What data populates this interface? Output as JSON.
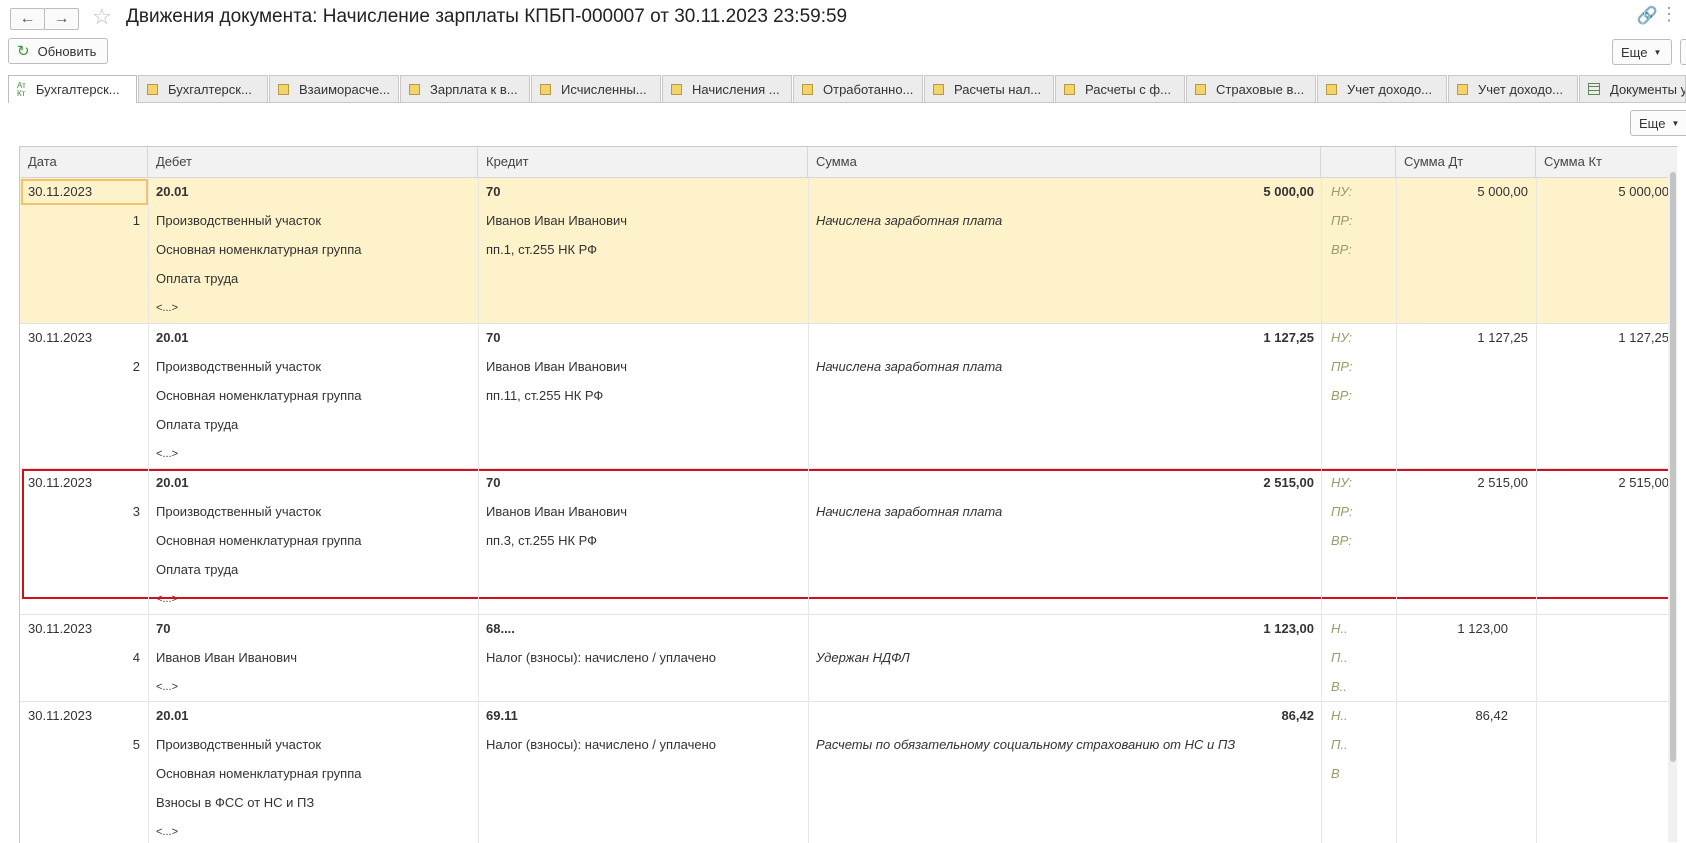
{
  "window": {
    "title": "Движения документа: Начисление зарплаты КПБП-000007 от 30.11.2023 23:59:59"
  },
  "toolbar": {
    "refresh_label": "Обновить",
    "more_label": "Еще",
    "more_label_table": "Еще"
  },
  "tabs": [
    {
      "label": "Бухгалтерск..."
    },
    {
      "label": "Бухгалтерск..."
    },
    {
      "label": "Взаиморасче..."
    },
    {
      "label": "Зарплата к в..."
    },
    {
      "label": "Исчисленны..."
    },
    {
      "label": "Начисления ..."
    },
    {
      "label": "Отработанно..."
    },
    {
      "label": "Расчеты нал..."
    },
    {
      "label": "Расчеты с ф..."
    },
    {
      "label": "Страховые в..."
    },
    {
      "label": "Учет доходо..."
    },
    {
      "label": "Учет доходо..."
    },
    {
      "label": "Документы у"
    }
  ],
  "table": {
    "columns": [
      "Дата",
      "Дебет",
      "Кредит",
      "Сумма",
      "",
      "Сумма Дт",
      "Сумма Кт"
    ],
    "rows": [
      {
        "date": "30.11.2023",
        "num": "1",
        "debit": [
          "20.01",
          "Производственный участок",
          "Основная номенклатурная группа",
          "Оплата труда",
          "<...>"
        ],
        "credit": [
          "70",
          "Иванов Иван Иванович",
          "пп.1, ст.255 НК РФ"
        ],
        "amount": "5 000,00",
        "content": "Начислена заработная плата",
        "tax": [
          "НУ:",
          "ПР:",
          "ВР:"
        ],
        "sum_dt": "5 000,00",
        "sum_kt": "5 000,00"
      },
      {
        "date": "30.11.2023",
        "num": "2",
        "debit": [
          "20.01",
          "Производственный участок",
          "Основная номенклатурная группа",
          "Оплата труда",
          "<...>"
        ],
        "credit": [
          "70",
          "Иванов Иван Иванович",
          "пп.11, ст.255 НК РФ"
        ],
        "amount": "1 127,25",
        "content": "Начислена заработная плата",
        "tax": [
          "НУ:",
          "ПР:",
          "ВР:"
        ],
        "sum_dt": "1 127,25",
        "sum_kt": "1 127,25"
      },
      {
        "date": "30.11.2023",
        "num": "3",
        "debit": [
          "20.01",
          "Производственный участок",
          "Основная номенклатурная группа",
          "Оплата труда",
          "<...>"
        ],
        "credit": [
          "70",
          "Иванов Иван Иванович",
          "пп.3, ст.255 НК РФ"
        ],
        "amount": "2 515,00",
        "content": "Начислена заработная плата",
        "tax": [
          "НУ:",
          "ПР:",
          "ВР:"
        ],
        "sum_dt": "2 515,00",
        "sum_kt": "2 515,00"
      },
      {
        "date": "30.11.2023",
        "num": "4",
        "debit": [
          "70",
          "Иванов Иван Иванович",
          "<...>"
        ],
        "credit": [
          "68....",
          "Налог (взносы): начислено / уплачено"
        ],
        "amount": "1 123,00",
        "content": "Удержан НДФЛ",
        "tax": [
          "Н..",
          "П..",
          "В.."
        ],
        "sum_dt": "1 123,00",
        "sum_kt": ""
      },
      {
        "date": "30.11.2023",
        "num": "5",
        "debit": [
          "20.01",
          "Производственный участок",
          "Основная номенклатурная группа",
          "Взносы в ФСС от НС и ПЗ",
          "<...>"
        ],
        "credit": [
          "69.11",
          "Налог (взносы): начислено / уплачено"
        ],
        "amount": "86,42",
        "content": "Расчеты по обязательному социальному страхованию от НС и ПЗ",
        "tax": [
          "Н..",
          "П..",
          "В"
        ],
        "sum_dt": "86,42",
        "sum_kt": ""
      }
    ]
  }
}
